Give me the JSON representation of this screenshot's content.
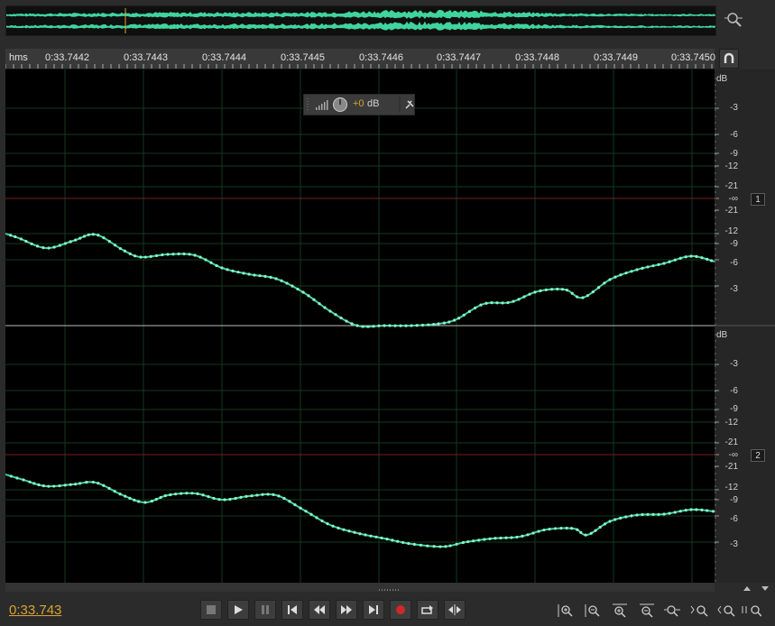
{
  "ruler": {
    "unit_label": "hms",
    "ticks": [
      "0:33.7442",
      "0:33.7443",
      "0:33.7444",
      "0:33.7445",
      "0:33.7446",
      "0:33.7447",
      "0:33.7448",
      "0:33.7449",
      "0:33.7450"
    ]
  },
  "db_scale": {
    "channel1": [
      "dB",
      "-3",
      "-6",
      "-9",
      "-12",
      "-21",
      "-∞",
      "-21",
      "-12",
      "-9",
      "-6",
      "-3"
    ],
    "channel2": [
      "dB",
      "-3",
      "-6",
      "-9",
      "-12",
      "-21",
      "-∞",
      "-21",
      "-12",
      "-9",
      "-6",
      "-3"
    ]
  },
  "channels": [
    {
      "badge": "1"
    },
    {
      "badge": "2"
    }
  ],
  "hud": {
    "value": "+0",
    "unit": "dB"
  },
  "transport": {
    "current_time": "0:33.743"
  },
  "colors": {
    "waveform": "#3fd4a0",
    "accent": "#d9a330",
    "zero_line": "#7a2020"
  }
}
